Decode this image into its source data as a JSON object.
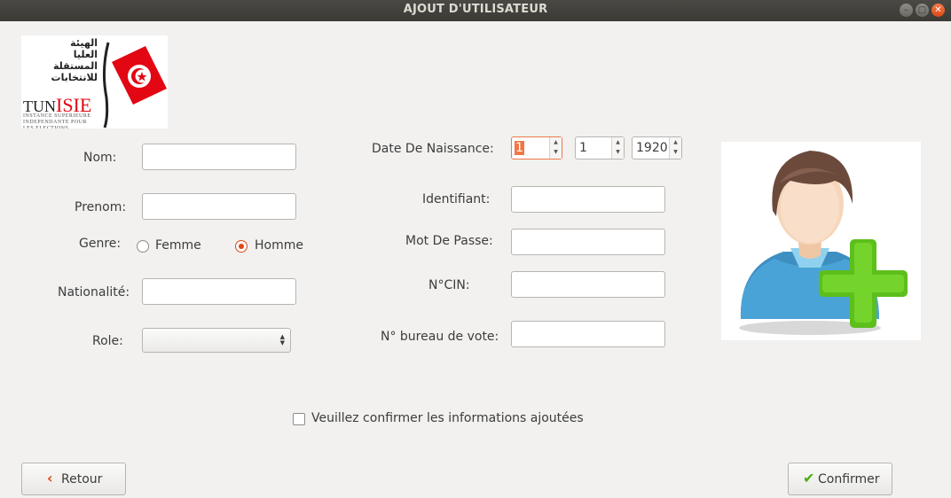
{
  "window": {
    "title": "AJOUT D'UTILISATEUR"
  },
  "logo": {
    "arabic_lines": [
      "الهيئة",
      "العليا",
      "المستقلة",
      "للانتخابات"
    ],
    "name_prefix": "TUN",
    "name_suffix": "ISIE",
    "subtitle": "INSTANCE SUPERIEURE INDEPENDANTE POUR LES ELECTIONS"
  },
  "form": {
    "nom": {
      "label": "Nom:",
      "value": ""
    },
    "prenom": {
      "label": "Prenom:",
      "value": ""
    },
    "genre": {
      "label": "Genre:",
      "options": [
        {
          "label": "Femme",
          "selected": false
        },
        {
          "label": "Homme",
          "selected": true
        }
      ]
    },
    "nationalite": {
      "label": "Nationalité:",
      "value": ""
    },
    "role": {
      "label": "Role:",
      "value": ""
    },
    "date_naissance": {
      "label": "Date De Naissance:",
      "day": "1",
      "month": "1",
      "year": "1920"
    },
    "identifiant": {
      "label": "Identifiant:",
      "value": ""
    },
    "mot_de_passe": {
      "label": "Mot De Passe:",
      "value": ""
    },
    "cin": {
      "label": "N°CIN:",
      "value": ""
    },
    "bureau_vote": {
      "label": "N° bureau de vote:",
      "value": ""
    }
  },
  "confirm_checkbox": {
    "label": "Veuillez confirmer les informations ajoutées",
    "checked": false
  },
  "buttons": {
    "retour": "Retour",
    "confirmer": "Confirmer"
  },
  "colors": {
    "accent": "#dd4814",
    "confirm_check": "#4caf0c"
  },
  "icons": {
    "photo": "user-add-icon",
    "retour": "chevron-left-icon",
    "confirmer": "checkmark-icon"
  }
}
